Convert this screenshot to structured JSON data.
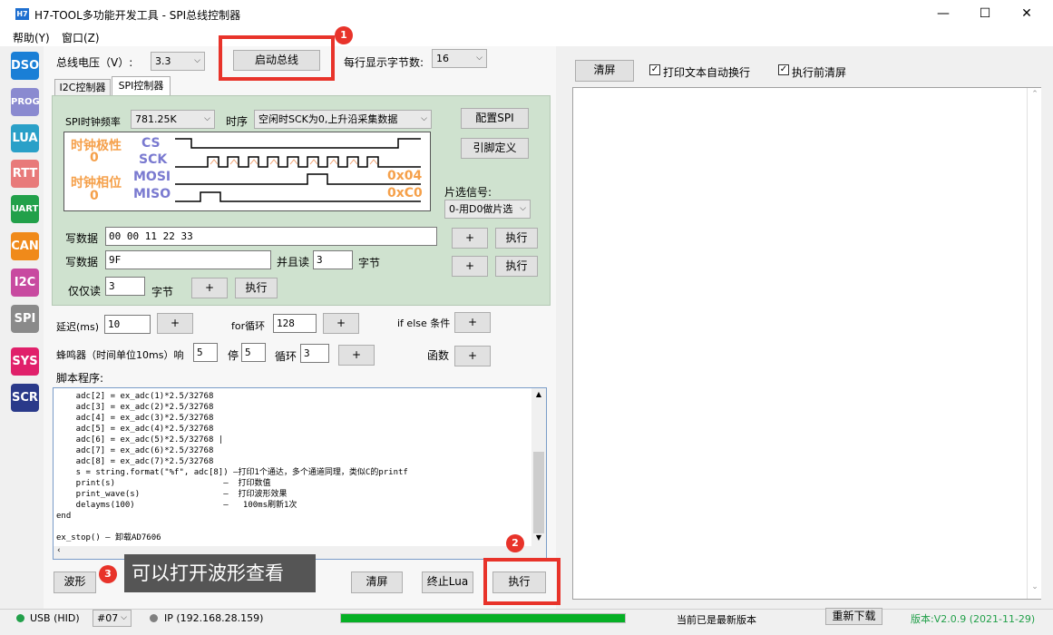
{
  "window": {
    "icon_text": "H7",
    "title": "H7-TOOL多功能开发工具 - SPI总线控制器",
    "minimize": "—",
    "maximize": "☐",
    "close": "✕"
  },
  "menu": [
    {
      "label": "帮助(Y)"
    },
    {
      "label": "窗口(Z)"
    }
  ],
  "sidebar": [
    {
      "label": "DSO",
      "color": "#1a7fd6"
    },
    {
      "label": "PROG",
      "color": "#8a8ad0"
    },
    {
      "label": "LUA",
      "color": "#2aa0c8"
    },
    {
      "label": "RTT",
      "color": "#e87a7a"
    },
    {
      "label": "UART",
      "color": "#22a04a"
    },
    {
      "label": "CAN",
      "color": "#f08a1a"
    },
    {
      "label": "I2C",
      "color": "#c84aa0"
    },
    {
      "label": "SPI",
      "color": "#8a8a8a"
    },
    {
      "label": "SYS",
      "color": "#e0206a"
    },
    {
      "label": "SCR",
      "color": "#2a3a8a"
    }
  ],
  "top": {
    "voltage_label": "总线电压（V）:",
    "voltage_value": "3.3",
    "start_bus": "启动总线",
    "bytes_per_line_label": "每行显示字节数:",
    "bytes_per_line_value": "16"
  },
  "tabs": [
    {
      "label": "I2C控制器"
    },
    {
      "label": "SPI控制器"
    }
  ],
  "spi": {
    "clock_label": "SPI时钟频率",
    "clock_value": "781.25K",
    "timing_label": "时序",
    "timing_value": "空闲时SCK为0,上升沿采集数据",
    "config_button": "配置SPI",
    "pin_def_button": "引脚定义",
    "polarity_label": "时钟极性",
    "polarity_value": "0",
    "phase_label": "时钟相位",
    "phase_value": "0",
    "signals": [
      "CS",
      "SCK",
      "MOSI",
      "MISO"
    ],
    "mosi_hex": "0x04",
    "miso_hex": "0xC0",
    "cs_label": "片选信号:",
    "cs_value": "0-用D0做片选",
    "write_label": "写数据",
    "write_value": "00 00 11 22 33",
    "write2_label": "写数据",
    "write2_value": "9F",
    "and_read_label": "并且读",
    "and_read_value": "3",
    "bytes_unit": "字节",
    "read_only_label": "仅仅读",
    "read_only_value": "3",
    "read_only_unit": "字节",
    "plus": "+",
    "exec": "执行"
  },
  "controls": {
    "delay_label": "延迟(ms)",
    "delay_value": "10",
    "for_label": "for循环",
    "for_value": "128",
    "ifelse_label": "if else 条件",
    "buzzer_label": "蜂鸣器（时间单位10ms）响",
    "buzzer_on": "5",
    "stop_label": "停",
    "buzzer_off": "5",
    "loop_label": "循环",
    "buzzer_loop": "3",
    "func_label": "函数",
    "plus": "+"
  },
  "script": {
    "label": "脚本程序:",
    "lines": [
      "    adc[2] = ex_adc(1)*2.5/32768",
      "    adc[3] = ex_adc(2)*2.5/32768",
      "    adc[4] = ex_adc(3)*2.5/32768",
      "    adc[5] = ex_adc(4)*2.5/32768",
      "    adc[6] = ex_adc(5)*2.5/32768 |",
      "    adc[7] = ex_adc(6)*2.5/32768",
      "    adc[8] = ex_adc(7)*2.5/32768",
      "    s = string.format(\"%f\", adc[8]) —打印1个通达，多个通道同理，类似C的printf",
      "    print(s)                      —  打印数值",
      "    print_wave(s)                 —  打印波形效果",
      "    delayms(100)                  —   100ms刷新1次",
      "end",
      "",
      "ex_stop() — 卸载AD7606"
    ]
  },
  "bottom": {
    "wave_button": "波形",
    "tooltip": "可以打开波形查看",
    "clear_button": "清屏",
    "stop_lua_button": "终止Lua",
    "exec_button": "执行"
  },
  "right": {
    "clear_button": "清屏",
    "auto_wrap": "打印文本自动换行",
    "clear_before": "执行前清屏"
  },
  "badges": {
    "one": "1",
    "two": "2",
    "three": "3"
  },
  "status": {
    "usb": "USB (HID)",
    "device": "#07",
    "ip": "IP (192.168.28.159)",
    "progress": 1.0,
    "update_msg": "当前已是最新版本",
    "redownload": "重新下载",
    "version": "版本:V2.0.9 (2021-11-29)"
  }
}
